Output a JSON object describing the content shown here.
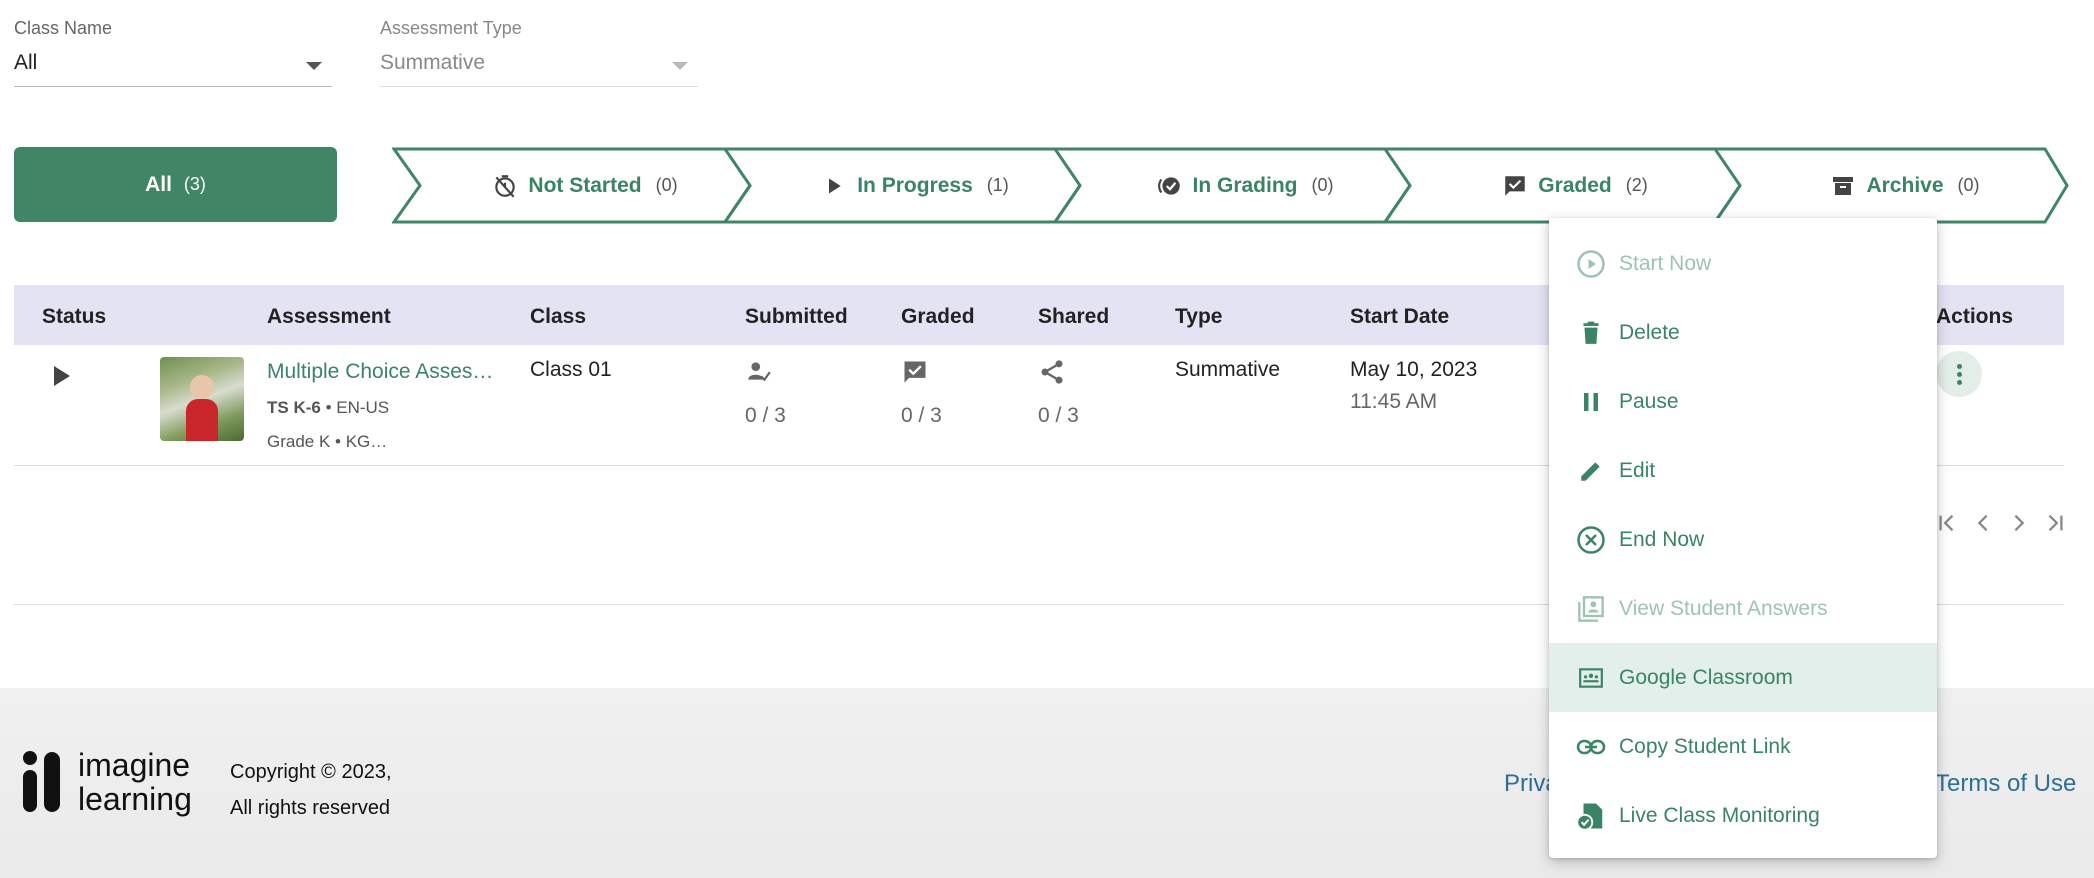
{
  "filters": {
    "class_name": {
      "label": "Class Name",
      "value": "All"
    },
    "assessment_type": {
      "label": "Assessment Type",
      "value": "Summative"
    }
  },
  "tabs": {
    "all": {
      "label": "All",
      "count": "(3)"
    },
    "not_started": {
      "label": "Not Started",
      "count": "(0)"
    },
    "in_progress": {
      "label": "In Progress",
      "count": "(1)"
    },
    "in_grading": {
      "label": "In Grading",
      "count": "(0)"
    },
    "graded": {
      "label": "Graded",
      "count": "(2)"
    },
    "archive": {
      "label": "Archive",
      "count": "(0)"
    }
  },
  "table": {
    "headers": {
      "status": "Status",
      "assessment": "Assessment",
      "class": "Class",
      "submitted": "Submitted",
      "graded": "Graded",
      "shared": "Shared",
      "type": "Type",
      "start_date": "Start Date",
      "actions": "Actions"
    },
    "row": {
      "title": "Multiple Choice Asses…",
      "program": "TS K-6",
      "locale": " • EN-US",
      "grade": "Grade K • KG…",
      "class": "Class 01",
      "submitted": "0 / 3",
      "graded": "0 / 3",
      "shared": "0 / 3",
      "type": "Summative",
      "date": "May 10, 2023",
      "time": "11:45 AM"
    }
  },
  "menu": {
    "start_now": "Start Now",
    "delete": "Delete",
    "pause": "Pause",
    "edit": "Edit",
    "end_now": "End Now",
    "view_answers": "View Student Answers",
    "google_classroom": "Google Classroom",
    "copy_link": "Copy Student Link",
    "live_monitoring": "Live Class Monitoring"
  },
  "footer": {
    "logo_line1": "imagine",
    "logo_line2": "learning",
    "copyright_line1": "Copyright © 2023,",
    "copyright_line2": "All rights reserved",
    "privacy_partial": "Priva",
    "terms": "Terms of Use"
  },
  "colors": {
    "accent": "#3f8566",
    "header_bg": "#e4e3f3",
    "link_blue": "#2d6e95"
  }
}
